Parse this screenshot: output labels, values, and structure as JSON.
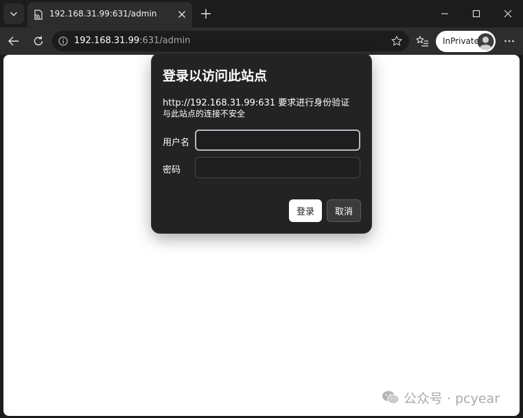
{
  "tab": {
    "title": "192.168.31.99:631/admin",
    "favicon": "page-warning-icon"
  },
  "address_bar": {
    "host": "192.168.31.99",
    "rest": ":631/admin"
  },
  "inprivate": {
    "label": "InPrivate"
  },
  "dialog": {
    "title": "登录以访问此站点",
    "message": "http://192.168.31.99:631 要求进行身份验证",
    "subtext": "与此站点的连接不安全",
    "username_label": "用户名",
    "username_value": "",
    "password_label": "密码",
    "password_value": "",
    "login_button": "登录",
    "cancel_button": "取消"
  },
  "watermark": {
    "text": "公众号 · pcyear"
  },
  "colors": {
    "frame": "#1c1c1c",
    "toolbar": "#2d2d2d",
    "dialog_bg": "#232323",
    "page_bg": "#ffffff"
  }
}
